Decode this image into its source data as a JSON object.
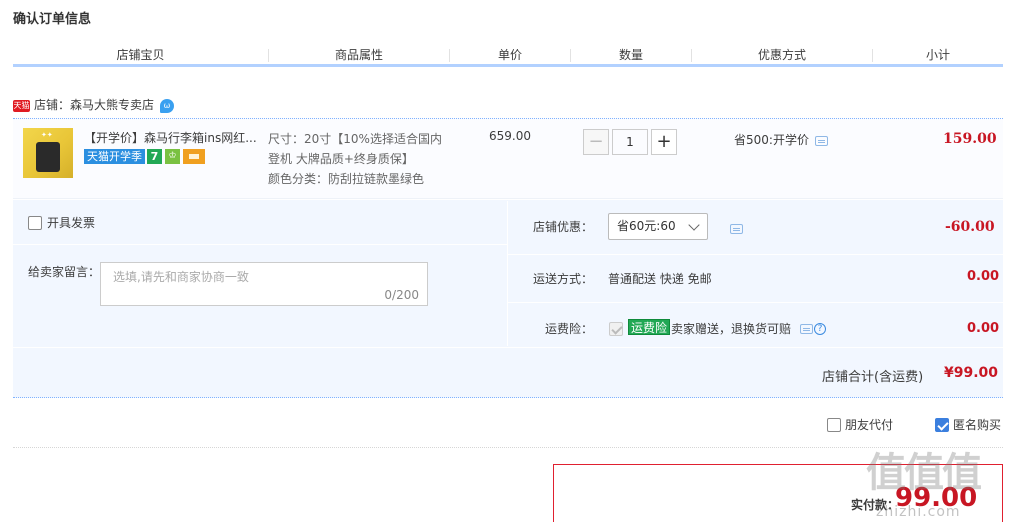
{
  "page_title": "确认订单信息",
  "columns": [
    "店铺宝贝",
    "商品属性",
    "单价",
    "数量",
    "优惠方式",
    "小计"
  ],
  "shop": {
    "badge": "天猫",
    "label": "店铺：森马大熊专卖店",
    "chat_icon": "wangwang-chat-icon"
  },
  "item": {
    "name": "【开学价】森马行李箱ins网红...",
    "tag_label": "天猫开学季",
    "tag_seven": "7",
    "attr_size": "尺寸：20寸【10%选择适合国内",
    "attr_size2": "登机 大牌品质+终身质保】",
    "attr_color": "颜色分类：防刮拉链款墨绿色",
    "unit_price": "659.00",
    "quantity": "1",
    "minus": "−",
    "plus": "+",
    "promo": "省500:开学价",
    "subtotal": "159.00"
  },
  "invoice_label": "开具发票",
  "message": {
    "label": "给卖家留言：",
    "placeholder": "选填,请先和商家协商一致",
    "count": "0/200"
  },
  "shop_discount": {
    "label": "店铺优惠：",
    "selected": "省60元:60",
    "value": "-60.00"
  },
  "shipping": {
    "label": "运送方式：",
    "value": "普通配送 快递 免邮",
    "price": "0.00"
  },
  "insurance": {
    "label": "运费险：",
    "tag": "运费险",
    "text": "卖家赠送，退换货可赔",
    "price": "0.00",
    "q": "?"
  },
  "shop_total": {
    "label": "店铺合计(含运费)",
    "value": "¥99.00"
  },
  "friend_pay_label": "朋友代付",
  "anonymous_label": "匿名购买",
  "actual_pay": {
    "label": "实付款：",
    "value": "99.00"
  },
  "watermark": {
    "big": "值值值",
    "small": "zhizhi.com"
  },
  "colors": {
    "accent": "#c81623",
    "header_line": "#b2d1ff",
    "panel": "#f2f7ff",
    "check": "#3b7fde"
  }
}
